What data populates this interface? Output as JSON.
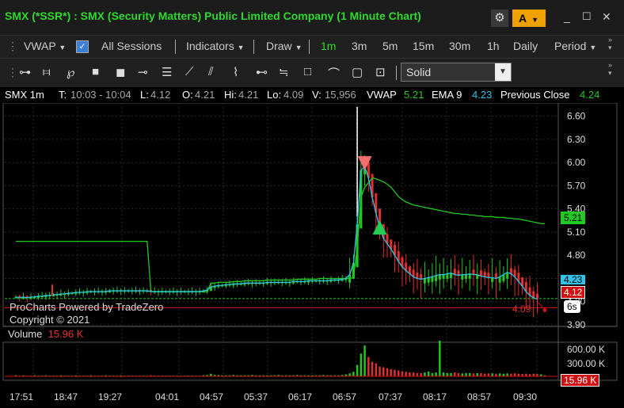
{
  "window": {
    "title": "SMX (*SSR*) : SMX (Security Matters) Public Limited Company (1 Minute Chart)",
    "account_button": "A",
    "minimize": "_",
    "maximize": "☐",
    "close": "✕"
  },
  "toolbar": {
    "vwap": "VWAP",
    "all_sessions": "All Sessions",
    "indicators": "Indicators",
    "draw": "Draw",
    "intervals": [
      "1m",
      "3m",
      "5m",
      "15m",
      "30m",
      "1h",
      "Daily"
    ],
    "active_interval": "1m",
    "period": "Period",
    "line_style": "Solid"
  },
  "info": {
    "symbol": "SMX 1m",
    "t_label": "T:",
    "time_range": "10:03 - 10:04",
    "l_label": "L:",
    "last": "4.12",
    "o_label": "O:",
    "open": "4.21",
    "hi_label": "Hi:",
    "high": "4.21",
    "lo_label": "Lo:",
    "low": "4.09",
    "v_label": "V:",
    "volume": "15,956",
    "vwap_label": "VWAP",
    "vwap": "5.21",
    "ema_label": "EMA 9",
    "ema": "4.23",
    "prev_close_label": "Previous Close",
    "prev_close": "4.24"
  },
  "price_axis": [
    "6.60",
    "6.30",
    "6.00",
    "5.70",
    "5.40",
    "5.10",
    "4.80",
    "4.50",
    "4.20",
    "3.90"
  ],
  "price_tags": {
    "vwap": "5.21",
    "ema": "4.23",
    "last": "4.12",
    "low": "4.09",
    "countdown": "6s"
  },
  "watermark": {
    "line1": "ProCharts Powered by TradeZero",
    "line2": "Copyright © 2021"
  },
  "volume_panel": {
    "label": "Volume",
    "value": "15.96 K",
    "axis": [
      "600.00 K",
      "300.00 K"
    ],
    "tag": "15.96 K"
  },
  "time_axis": [
    "17:51",
    "18:47",
    "19:27",
    "04:01",
    "04:57",
    "05:37",
    "06:17",
    "06:57",
    "07:37",
    "08:17",
    "08:57",
    "09:30"
  ],
  "colors": {
    "title": "#2ed82e",
    "vwap": "#21c921",
    "ema": "#31c4e8",
    "up": "#21c921",
    "down": "#e23030",
    "accent": "#f0a000"
  },
  "chart_data": {
    "type": "line",
    "series": [
      {
        "name": "VWAP",
        "values": [
          4.98,
          4.98,
          4.98,
          4.98,
          4.98,
          4.98,
          4.98,
          4.98,
          4.98,
          4.98,
          4.98,
          4.98,
          4.98,
          4.98,
          4.98,
          4.98,
          4.98,
          4.98,
          4.98,
          4.98,
          4.98,
          4.98,
          4.98,
          4.98,
          4.98,
          4.98,
          4.98,
          4.98,
          4.98,
          4.98,
          4.98,
          4.98,
          4.98,
          4.98,
          4.98,
          4.98,
          4.33,
          4.33,
          4.33,
          4.33,
          4.33,
          4.33,
          4.33,
          4.33,
          4.33,
          4.33,
          4.33,
          4.33,
          4.33,
          4.33,
          4.33,
          4.33,
          4.44,
          4.44,
          4.45,
          4.45,
          4.45,
          4.45,
          4.46,
          4.46,
          4.46,
          4.47,
          4.47,
          4.47,
          4.47,
          4.47,
          4.47,
          4.48,
          4.48,
          4.48,
          4.48,
          4.48,
          4.48,
          4.48,
          4.48,
          4.49,
          4.49,
          4.49,
          4.49,
          4.49,
          4.49,
          4.5,
          4.5,
          4.5,
          4.5,
          4.5,
          4.5,
          4.5,
          4.5,
          4.5,
          4.51,
          4.9,
          5.55,
          5.68,
          5.74,
          5.8,
          5.79,
          5.77,
          5.75,
          5.72,
          5.68,
          5.62,
          5.56,
          5.52,
          5.49,
          5.47,
          5.45,
          5.44,
          5.43,
          5.42,
          5.41,
          5.4,
          5.39,
          5.38,
          5.37,
          5.36,
          5.35,
          5.34,
          5.34,
          5.33,
          5.33,
          5.32,
          5.32,
          5.31,
          5.31,
          5.3,
          5.3,
          5.3,
          5.29,
          5.29,
          5.29,
          5.28,
          5.28,
          5.27,
          5.27,
          5.26,
          5.25,
          5.24,
          5.23,
          5.22,
          5.21,
          5.21
        ]
      },
      {
        "name": "EMA 9",
        "values": [
          4.26,
          4.25,
          4.26,
          4.25,
          4.26,
          4.26,
          4.27,
          4.27,
          4.28,
          4.28,
          4.29,
          4.29,
          4.3,
          4.3,
          4.31,
          4.31,
          4.32,
          4.32,
          4.32,
          4.33,
          4.33,
          4.33,
          4.33,
          4.33,
          4.33,
          4.34,
          4.34,
          4.34,
          4.34,
          4.34,
          4.34,
          4.34,
          4.34,
          4.34,
          4.34,
          4.34,
          4.33,
          4.33,
          4.33,
          4.33,
          4.33,
          4.33,
          4.33,
          4.33,
          4.33,
          4.33,
          4.33,
          4.33,
          4.33,
          4.33,
          4.34,
          4.35,
          4.39,
          4.4,
          4.41,
          4.41,
          4.42,
          4.42,
          4.43,
          4.43,
          4.43,
          4.44,
          4.44,
          4.44,
          4.44,
          4.44,
          4.44,
          4.45,
          4.45,
          4.45,
          4.45,
          4.45,
          4.45,
          4.45,
          4.46,
          4.46,
          4.46,
          4.46,
          4.47,
          4.47,
          4.47,
          4.47,
          4.47,
          4.47,
          4.48,
          4.48,
          4.48,
          4.49,
          4.5,
          4.55,
          4.7,
          5.2,
          5.9,
          5.95,
          5.8,
          5.55,
          5.35,
          5.15,
          5.02,
          4.95,
          4.88,
          4.8,
          4.72,
          4.65,
          4.6,
          4.56,
          4.52,
          4.5,
          4.49,
          4.5,
          4.51,
          4.52,
          4.54,
          4.55,
          4.55,
          4.56,
          4.57,
          4.55,
          4.54,
          4.55,
          4.55,
          4.56,
          4.55,
          4.55,
          4.53,
          4.52,
          4.51,
          4.51,
          4.5,
          4.52,
          4.55,
          4.58,
          4.56,
          4.52,
          4.46,
          4.4,
          4.33,
          4.28,
          4.25,
          4.23
        ]
      }
    ],
    "volume": [
      3,
      2,
      3,
      2,
      2,
      3,
      2,
      2,
      3,
      2,
      2,
      2,
      3,
      2,
      2,
      2,
      3,
      2,
      2,
      2,
      3,
      2,
      2,
      2,
      3,
      2,
      2,
      2,
      3,
      2,
      2,
      2,
      2,
      2,
      2,
      2,
      3,
      2,
      2,
      2,
      2,
      2,
      2,
      2,
      2,
      2,
      2,
      2,
      2,
      2,
      3,
      4,
      8,
      4,
      4,
      3,
      3,
      3,
      4,
      3,
      3,
      3,
      3,
      4,
      3,
      3,
      3,
      3,
      3,
      3,
      4,
      3,
      3,
      3,
      3,
      4,
      3,
      3,
      3,
      3,
      3,
      3,
      4,
      3,
      3,
      3,
      3,
      4,
      6,
      9,
      14,
      35,
      70,
      95,
      60,
      45,
      40,
      30,
      28,
      25,
      22,
      20,
      18,
      16,
      14,
      12,
      12,
      10,
      10,
      12,
      15,
      10,
      12,
      110,
      12,
      10,
      10,
      12,
      10,
      9,
      10,
      10,
      9,
      10,
      10,
      8,
      9,
      9,
      8,
      9,
      8,
      9,
      8,
      9,
      8,
      7,
      8,
      7,
      8,
      7,
      6,
      3
    ],
    "ylim": [
      3.9,
      6.75
    ]
  }
}
